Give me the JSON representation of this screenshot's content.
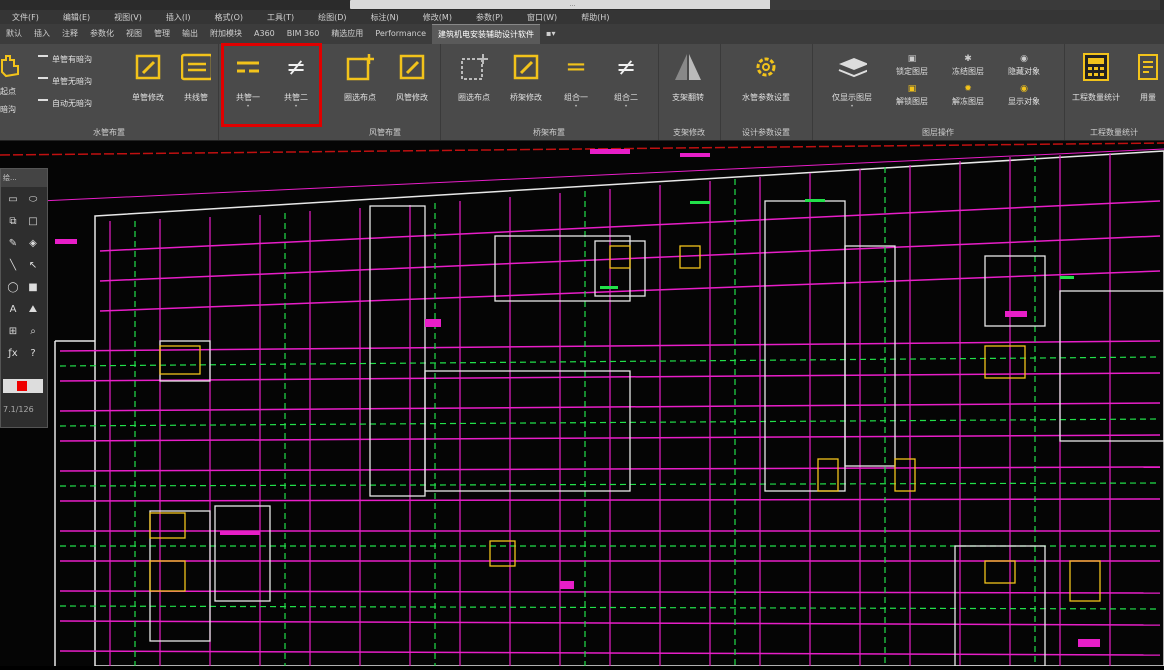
{
  "title_bar": {
    "document": "..."
  },
  "menu": [
    "文件(F)",
    "编辑(E)",
    "视图(V)",
    "插入(I)",
    "格式(O)",
    "工具(T)",
    "绘图(D)",
    "标注(N)",
    "修改(M)",
    "参数(P)",
    "窗口(W)",
    "帮助(H)"
  ],
  "tabs": [
    {
      "label": "默认"
    },
    {
      "label": "插入"
    },
    {
      "label": "注释"
    },
    {
      "label": "参数化"
    },
    {
      "label": "视图"
    },
    {
      "label": "管理"
    },
    {
      "label": "输出"
    },
    {
      "label": "附加模块"
    },
    {
      "label": "A360"
    },
    {
      "label": "BIM 360"
    },
    {
      "label": "精选应用"
    },
    {
      "label": "Performance"
    },
    {
      "label": "建筑机电安装辅助设计软件",
      "active": true
    }
  ],
  "ribbon": {
    "water_panel": {
      "title": "水管布置",
      "small_tools": [
        "单管有暗沟",
        "单管无暗沟",
        "自动无暗沟"
      ],
      "left_labels": [
        "起点",
        "暗沟"
      ],
      "tools": [
        "单管修改",
        "共线管",
        "共管一",
        "共管二"
      ]
    },
    "duct_panel": {
      "title": "风管布置",
      "tools": [
        "圈选布点",
        "风管修改"
      ]
    },
    "bridge_panel": {
      "title": "桥架布置",
      "tools": [
        "圈选布点",
        "桥架修改",
        "组合一",
        "组合二"
      ]
    },
    "support_panel": {
      "title": "支架修改",
      "tools": [
        "支架翻转"
      ]
    },
    "param_panel": {
      "title": "设计参数设置",
      "tools": [
        "水管参数设置"
      ]
    },
    "layer_panel": {
      "title": "图层操作",
      "big_tool": "仅显示图层",
      "small_tools": [
        "锁定图层",
        "冻结图层",
        "隐藏对象",
        "解锁图层",
        "解冻图层",
        "显示对象"
      ]
    },
    "stats_panel": {
      "title": "工程数量统计",
      "tools": [
        "工程数量统计",
        "用量"
      ]
    }
  },
  "float_toolbar": {
    "title": "绘...",
    "coord": "7.1/126"
  },
  "colors": {
    "accent_red": "#e00000",
    "icon_yellow": "#f2c31b",
    "pipe_magenta": "#e81ec8",
    "pipe_green": "#22e04a"
  }
}
